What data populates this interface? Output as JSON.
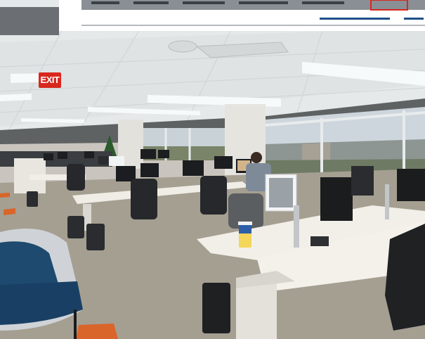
{
  "scene": {
    "description_free": true,
    "exit_sign": {
      "text": "EXIT",
      "color": "#d8281e"
    },
    "cup": {
      "label": ""
    },
    "colors": {
      "ceiling": "#e9ecec",
      "carpet": "#a39d90",
      "wall_dark": "#5c5f60",
      "desk": "#efece6",
      "chair": "#2a2c2f",
      "lounge_chair": "#1d4a6e",
      "accent_orange": "#d9652a",
      "sky": "#cfd8df"
    }
  }
}
